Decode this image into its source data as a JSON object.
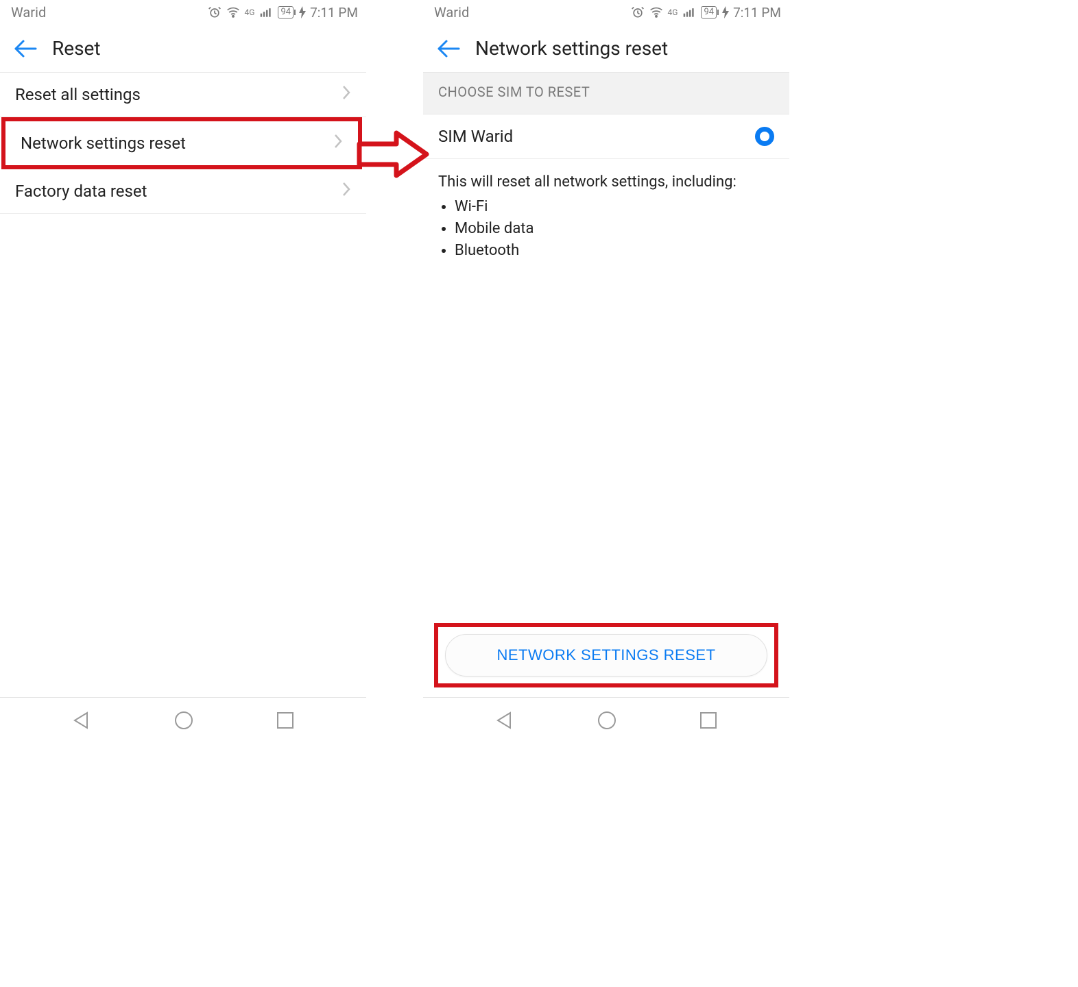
{
  "status": {
    "carrier": "Warid",
    "battery_pct": "94",
    "time": "7:11 PM",
    "net_label": "4G"
  },
  "left": {
    "title": "Reset",
    "rows": [
      {
        "label": "Reset all settings"
      },
      {
        "label": "Network settings reset"
      },
      {
        "label": "Factory data reset"
      }
    ]
  },
  "right": {
    "title": "Network settings reset",
    "section_header": "CHOOSE SIM TO RESET",
    "sim_label": "SIM  Warid",
    "info_text": "This will reset all network settings, including:",
    "bullets": [
      "Wi-Fi",
      "Mobile data",
      "Bluetooth"
    ],
    "button_label": "NETWORK SETTINGS RESET"
  }
}
